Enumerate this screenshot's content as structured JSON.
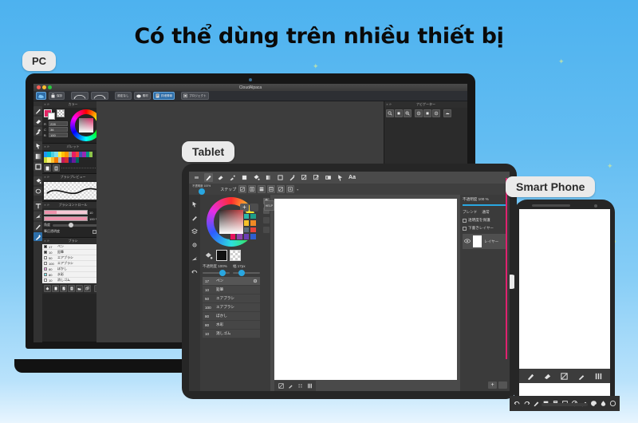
{
  "headline": "Có thể dùng trên nhiều thiết bị",
  "badges": {
    "pc": "PC",
    "tablet": "Tablet",
    "phone": "Smart Phone"
  },
  "colors": {
    "background_top": "#4db2ef",
    "background_bottom": "#e8f5fe",
    "accent_pink": "#e0216f",
    "accent_blue": "#29a7e1",
    "badge_bg": "#eaeaea",
    "app_panel": "#2b2b2b",
    "swatch_primary": "#e42464"
  },
  "laptop": {
    "window_title": "CloudAlpaca",
    "traffic_lights": [
      "close-red",
      "minimize-yellow",
      "maximize-green"
    ],
    "toolbar": [
      {
        "icon": "cloud-icon",
        "label": "",
        "selected": true
      },
      {
        "icon": "save-icon",
        "label": "保存",
        "selected": false
      },
      {
        "icon": "undo-arc-icon",
        "label": "",
        "selected": false
      },
      {
        "icon": "redo-arc-icon",
        "label": "",
        "selected": false
      },
      {
        "icon": "none-icon",
        "label": "設定なし",
        "selected": false
      },
      {
        "icon": "material-icon",
        "label": "素材",
        "selected": false
      },
      {
        "icon": "info-icon",
        "label": "詳細情報",
        "selected": true
      },
      {
        "icon": "project-icon",
        "label": "プロジェクト",
        "selected": false
      }
    ],
    "tool_rail": [
      "pen-icon",
      "eraser-icon",
      "brush-icon",
      "divider",
      "select-arrow-icon",
      "gradient-icon",
      "frame-icon",
      "divider",
      "bucket-icon",
      "lasso-icon",
      "divider",
      "text-icon",
      "move-icon",
      "pencil-icon",
      "wand-icon"
    ],
    "panels": {
      "color": {
        "title": "カラー",
        "rgb": [
          {
            "label": "R",
            "value": "228"
          },
          {
            "label": "C",
            "value": "36"
          },
          {
            "label": "B",
            "value": "100"
          }
        ]
      },
      "palette": {
        "title": "パレット",
        "swatches": [
          "#2196f3",
          "#00bcd4",
          "#4dd0e1",
          "#80deea",
          "#ffeb3b",
          "#ffc107",
          "#ff9800",
          "#9e9e9e",
          "#e91e63",
          "#f44336",
          "#3f51b5",
          "#9c27b0",
          "#009688",
          "#8bc34a",
          "#cddc39",
          "#fff176",
          "#fbc02d",
          "#f57c00",
          "#bdbdbd",
          "#c2185b",
          "#d32f2f",
          "#1a237e",
          "#6a1b9a",
          "#00695c"
        ],
        "buttons": [
          "new-palette-icon",
          "delete-palette-icon"
        ]
      },
      "brush_preview": {
        "title": "ブラシプレビュー"
      },
      "brush_control": {
        "title": "ブラシコントロール",
        "size_value": "10",
        "opacity_value": "100 %",
        "angle_label": "角度",
        "angle_value": "0",
        "pressure_label": "筆圧透明度"
      },
      "brush_list": {
        "title": "ブラシ",
        "items": [
          {
            "swatch": "#222222",
            "num": "17",
            "name": "ペン"
          },
          {
            "swatch": "#333333",
            "num": "10",
            "name": "鉛筆"
          },
          {
            "swatch": "#ffffff",
            "num": "50",
            "name": "エアブラシ"
          },
          {
            "swatch": "#ffffff",
            "num": "100",
            "name": "エアブラシ"
          },
          {
            "swatch": "#f0a8e8",
            "num": "80",
            "name": "ぼかし"
          },
          {
            "swatch": "#7fe3f0",
            "num": "80",
            "name": "水彩"
          },
          {
            "swatch": "#ffffff",
            "num": "10",
            "name": "消しゴム"
          }
        ],
        "footer_buttons": [
          "brush-shape-icon",
          "new-layer-icon",
          "copy-layer-icon",
          "duplicate-layer-icon",
          "folder-icon",
          "merge-icon",
          "trash-icon"
        ]
      },
      "navigator": {
        "title": "ナビゲーター",
        "buttons": [
          "zoom-in-icon",
          "zoom-fit-icon",
          "zoom-out-icon",
          "rotate-left-icon",
          "rotate-reset-icon",
          "rotate-right-icon",
          "flip-icon"
        ]
      }
    }
  },
  "tablet": {
    "toolbar": [
      {
        "icon": "pen-icon",
        "selected": true
      },
      {
        "icon": "eraser-icon",
        "selected": false
      },
      {
        "icon": "blur-icon",
        "selected": false
      },
      {
        "icon": "fill-icon",
        "selected": false
      },
      {
        "icon": "bucket-icon",
        "selected": false
      },
      {
        "icon": "gradient-icon",
        "selected": false
      },
      {
        "icon": "select-rect-icon",
        "selected": false
      },
      {
        "icon": "wand-icon",
        "selected": false
      },
      {
        "icon": "transform-icon",
        "selected": false
      },
      {
        "icon": "move-icon",
        "selected": false
      },
      {
        "icon": "canvas-icon",
        "selected": false
      },
      {
        "icon": "pointer-icon",
        "selected": false
      },
      {
        "icon": "text-icon",
        "label": "Aa",
        "selected": false
      }
    ],
    "step_row": {
      "label": "ステップ",
      "buttons": [
        "step-1-icon",
        "step-2-icon",
        "step-3-icon",
        "step-4-icon",
        "step-5-icon",
        "step-6-icon"
      ]
    },
    "left_panel": {
      "opacity_label": "不透明度 100%",
      "width_label": "幅 17px",
      "add_button": "+",
      "swatches": [
        "#3b9ae1",
        "#4fc3e8",
        "#2bb7a9",
        "#1e9e8a",
        "#8cc63f",
        "#f4e04d",
        "#f6c12a",
        "#f08a24",
        "#b9b9b9",
        "#7f8c8d",
        "#5d6d7e",
        "#e8433a",
        "#e5125e",
        "#8e44ad",
        "#6c3fb5",
        "#2f5fd0"
      ],
      "brush_items": [
        {
          "num": "17",
          "name": "ペン",
          "selected": true
        },
        {
          "num": "10",
          "name": "鉛筆",
          "selected": false
        },
        {
          "num": "50",
          "name": "エアブラシ",
          "selected": false
        },
        {
          "num": "100",
          "name": "エアブラシ",
          "selected": false
        },
        {
          "num": "80",
          "name": "ぼかし",
          "selected": false
        },
        {
          "num": "80",
          "name": "水彩",
          "selected": false
        },
        {
          "num": "10",
          "name": "消しゴム",
          "selected": false
        }
      ]
    },
    "right_panel": {
      "opacity_label": "不透明度 100 %",
      "blend_label": "ブレンド",
      "blend_value": "通常",
      "protect_alpha": "透明度を保護",
      "draft_layer": "下書きレイヤー",
      "layer_name": "レイヤー",
      "buttons": [
        "add-layer-icon",
        "delete-layer-icon"
      ]
    },
    "canvas_tools": [
      "select-none-icon",
      "eyedropper-icon",
      "grid-icon",
      "columns-icon"
    ],
    "help_badge": "HELP"
  },
  "phone": {
    "toolbar_row1": [
      "pen-icon",
      "eraser-icon",
      "select-none-icon",
      "eyedropper-icon",
      "columns-icon"
    ],
    "toolbar_row2": [
      "undo-icon",
      "redo-icon",
      "pencil-icon",
      "fill-square-icon",
      "page-icon",
      "select-rect-icon",
      "no-icon",
      "brush-icon",
      "palette-icon",
      "drop-icon",
      "circle-icon"
    ]
  }
}
